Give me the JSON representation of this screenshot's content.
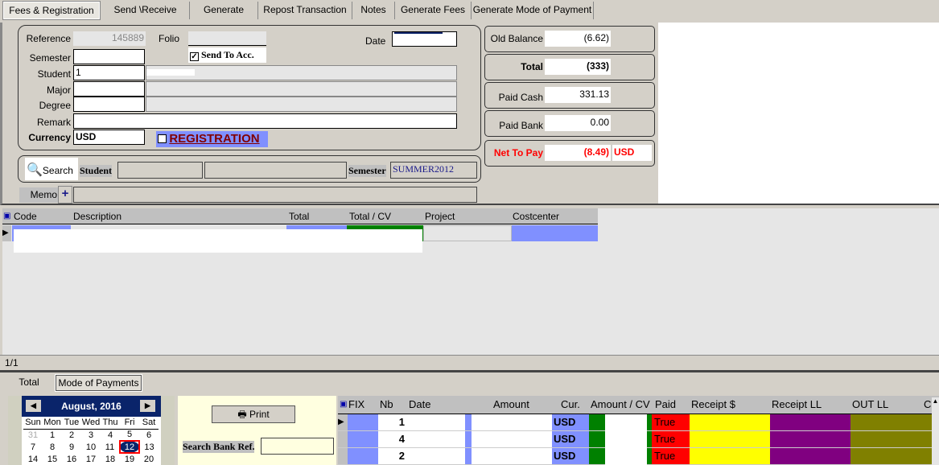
{
  "tabs": [
    "Fees  & Registration",
    "Send \\Receive",
    "Generate",
    "Repost Transaction",
    "Notes",
    "Generate Fees",
    "Generate Mode of Payment"
  ],
  "form": {
    "reference_label": "Reference",
    "reference_value": "145889",
    "folio_label": "Folio",
    "date_label": "Date",
    "semester_label": "Semester",
    "send_to_acc_label": "Send To Acc.",
    "send_to_acc_checked": true,
    "student_label": "Student",
    "student_value": "1",
    "major_label": "Major",
    "degree_label": "Degree",
    "remark_label": "Remark",
    "currency_label": "Currency",
    "currency_value": "USD",
    "registration_label": "REGISTRATION",
    "registration_checked": false
  },
  "search": {
    "button_label": "Search",
    "student_label": "Student",
    "semester_label": "Semester",
    "semester_value": "SUMMER2012"
  },
  "memo": {
    "label": "Memo",
    "add_label": "+"
  },
  "summary": {
    "old_balance_label": "Old Balance",
    "old_balance": "(6.62)",
    "total_label": "Total",
    "total": "(333)",
    "paid_cash_label": "Paid Cash",
    "paid_cash": "331.13",
    "paid_bank_label": "Paid Bank",
    "paid_bank": "0.00",
    "net_label": "Net To Pay",
    "net": "(8.49)",
    "net_currency": "USD"
  },
  "fees_grid": {
    "columns": [
      "Code",
      "Description",
      "Total",
      "Total / CV",
      "Project",
      "Costcenter"
    ],
    "record_count": "1/1"
  },
  "bottom_tabs": [
    "Total",
    "Mode of Payments"
  ],
  "calendar": {
    "month": "August, 2016",
    "days": [
      "Sun",
      "Mon",
      "Tue",
      "Wed",
      "Thu",
      "Fri",
      "Sat"
    ],
    "weeks": [
      [
        "31",
        "1",
        "2",
        "3",
        "4",
        "5",
        "6"
      ],
      [
        "7",
        "8",
        "9",
        "10",
        "11",
        "12",
        "13"
      ],
      [
        "14",
        "15",
        "16",
        "17",
        "18",
        "19",
        "20"
      ]
    ],
    "selected": "12"
  },
  "print_label": "Print",
  "search_bank_label": "Search Bank Ref.",
  "payments_grid": {
    "columns": [
      "FIX",
      "Nb",
      "Date",
      "Amount",
      "Cur.",
      "Amount / CV",
      "Paid",
      "Receipt $",
      "Receipt LL",
      "OUT LL",
      "C"
    ],
    "rows": [
      {
        "nb": "1",
        "cur": "USD",
        "paid": "True"
      },
      {
        "nb": "4",
        "cur": "USD",
        "paid": "True"
      },
      {
        "nb": "2",
        "cur": "USD",
        "paid": "True"
      }
    ]
  },
  "colors": {
    "blue": "#8090ff",
    "green": "#008000",
    "red": "#ff0000",
    "yellow": "#ffff00",
    "purple": "#800080",
    "olive": "#808000",
    "calendar_header": "#0a246a"
  }
}
